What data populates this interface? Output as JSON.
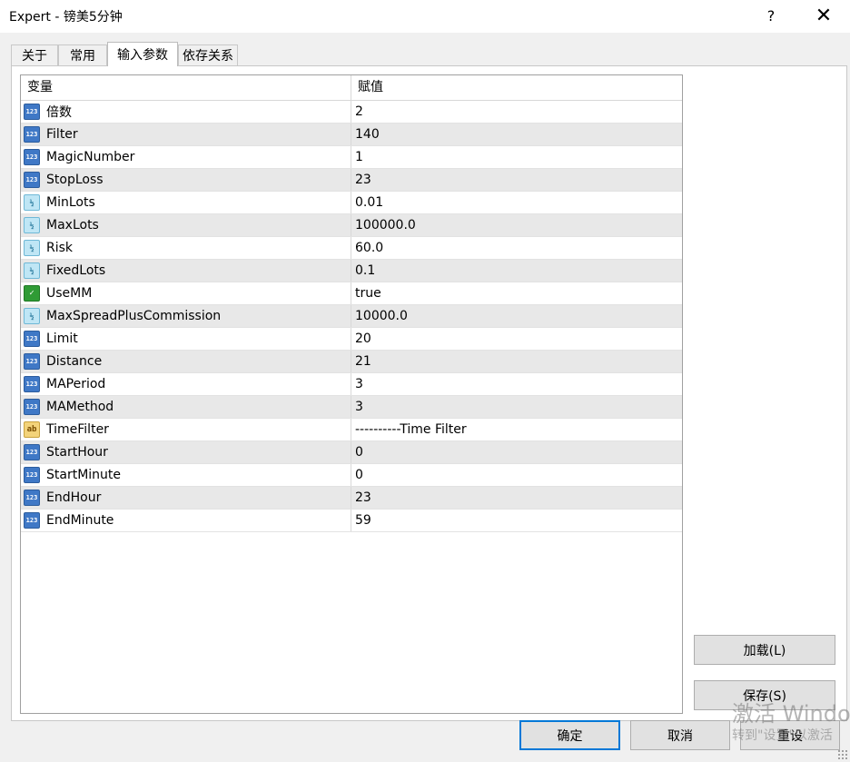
{
  "window": {
    "title": "Expert - 镑美5分钟",
    "help": "?",
    "close": "✕"
  },
  "tabs": [
    {
      "label": "关于",
      "active": false
    },
    {
      "label": "常用",
      "active": false
    },
    {
      "label": "输入参数",
      "active": true
    },
    {
      "label": "依存关系",
      "active": false
    }
  ],
  "grid": {
    "headers": {
      "variable": "变量",
      "value": "赋值"
    },
    "rows": [
      {
        "type": "int",
        "name": "倍数",
        "value": "2"
      },
      {
        "type": "int",
        "name": "Filter",
        "value": "140"
      },
      {
        "type": "int",
        "name": "MagicNumber",
        "value": "1"
      },
      {
        "type": "int",
        "name": "StopLoss",
        "value": "23"
      },
      {
        "type": "double",
        "name": "MinLots",
        "value": "0.01"
      },
      {
        "type": "double",
        "name": "MaxLots",
        "value": "100000.0"
      },
      {
        "type": "double",
        "name": "Risk",
        "value": "60.0"
      },
      {
        "type": "double",
        "name": "FixedLots",
        "value": "0.1"
      },
      {
        "type": "bool",
        "name": "UseMM",
        "value": "true"
      },
      {
        "type": "double",
        "name": "MaxSpreadPlusCommission",
        "value": "10000.0"
      },
      {
        "type": "int",
        "name": "Limit",
        "value": "20"
      },
      {
        "type": "int",
        "name": "Distance",
        "value": "21"
      },
      {
        "type": "int",
        "name": "MAPeriod",
        "value": "3"
      },
      {
        "type": "int",
        "name": "MAMethod",
        "value": "3"
      },
      {
        "type": "string",
        "name": "TimeFilter",
        "value": "----------Time Filter"
      },
      {
        "type": "int",
        "name": "StartHour",
        "value": "0"
      },
      {
        "type": "int",
        "name": "StartMinute",
        "value": "0"
      },
      {
        "type": "int",
        "name": "EndHour",
        "value": "23"
      },
      {
        "type": "int",
        "name": "EndMinute",
        "value": "59"
      }
    ]
  },
  "icons": {
    "int": "123",
    "double": "½",
    "bool": "✓",
    "string": "ab"
  },
  "buttons": {
    "load": "加载(L)",
    "save": "保存(S)",
    "ok": "确定",
    "cancel": "取消",
    "reset": "重设"
  },
  "watermark": {
    "line1": "激活 Windows",
    "line2": "转到\"设置\"以激活"
  }
}
